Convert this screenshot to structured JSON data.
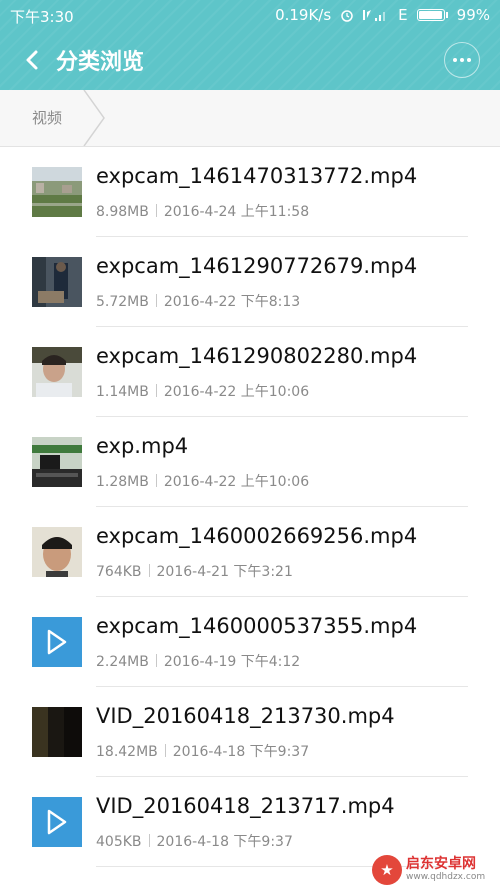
{
  "status_bar": {
    "time": "下午3:30",
    "speed": "0.19K/s",
    "network": "E",
    "battery": "99%"
  },
  "titlebar": {
    "title": "分类浏览"
  },
  "breadcrumb": {
    "current": "视频"
  },
  "files": [
    {
      "name": "expcam_1461470313772.mp4",
      "size": "8.98MB",
      "date": "2016-4-24 上午11:58",
      "thumb": "aerial"
    },
    {
      "name": "expcam_1461290772679.mp4",
      "size": "5.72MB",
      "date": "2016-4-22 下午8:13",
      "thumb": "room"
    },
    {
      "name": "expcam_1461290802280.mp4",
      "size": "1.14MB",
      "date": "2016-4-22 上午10:06",
      "thumb": "person"
    },
    {
      "name": "exp.mp4",
      "size": "1.28MB",
      "date": "2016-4-22 上午10:06",
      "thumb": "desk"
    },
    {
      "name": "expcam_1460002669256.mp4",
      "size": "764KB",
      "date": "2016-4-21 下午3:21",
      "thumb": "face"
    },
    {
      "name": "expcam_1460000537355.mp4",
      "size": "2.24MB",
      "date": "2016-4-19 下午4:12",
      "thumb": "video-icon"
    },
    {
      "name": "VID_20160418_213730.mp4",
      "size": "18.42MB",
      "date": "2016-4-18 下午9:37",
      "thumb": "dark"
    },
    {
      "name": "VID_20160418_213717.mp4",
      "size": "405KB",
      "date": "2016-4-18 下午9:37",
      "thumb": "video-icon"
    }
  ],
  "watermark": {
    "name": "启东安卓网",
    "url": "www.qdhdzx.com"
  },
  "colors": {
    "header": "#5ec5c9",
    "video_icon": "#3a9ad9"
  }
}
